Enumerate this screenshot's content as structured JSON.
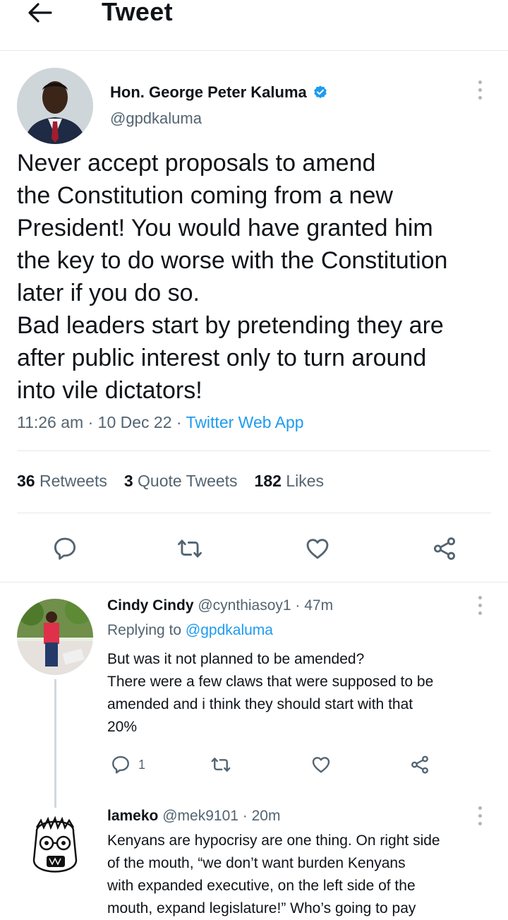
{
  "header": {
    "title": "Tweet",
    "back_icon": "arrow-left-icon"
  },
  "tweet": {
    "author_name": "Hon. George Peter Kaluma",
    "author_handle": "@gpdkaluma",
    "verified_icon": "verified-badge-icon",
    "text_lines": [
      "Never accept proposals to amend",
      "the Constitution coming from a new",
      "President! You would have granted him",
      "the key to do worse with the Constitution",
      "later if you do so.",
      "Bad leaders start by pretending they are",
      "after public interest only to turn around",
      "into vile dictators!"
    ],
    "time": "11:26 am",
    "date": "10 Dec 22",
    "source": "Twitter Web App",
    "stats": {
      "retweets_count": "36",
      "retweets_label": "Retweets",
      "quotes_count": "3",
      "quotes_label": "Quote Tweets",
      "likes_count": "182",
      "likes_label": "Likes"
    },
    "actions": [
      "reply-icon",
      "retweet-icon",
      "like-icon",
      "share-icon"
    ]
  },
  "replies": [
    {
      "name": "Cindy Cindy",
      "handle": "@cynthiasoy1",
      "age": "47m",
      "replying_label": "Replying to",
      "replying_to": "@gpdkaluma",
      "text_lines": [
        "But was it not planned to be amended?",
        "There were a few claws that were supposed to be",
        "amended and i think they should start with that",
        "20%"
      ],
      "reply_count": "1"
    },
    {
      "name": "lameko",
      "handle": "@mek9101",
      "age": "20m",
      "text_lines": [
        "Kenyans are hypocrisy are one thing. On right side",
        "of the mouth, “we don’t want burden Kenyans",
        "with expanded executive, on the left side of the",
        "mouth, expand legislature!” Who’s going to pay"
      ]
    }
  ],
  "colors": {
    "accent": "#1d9bf0",
    "muted": "#536471",
    "divider": "#e4e7ea"
  }
}
